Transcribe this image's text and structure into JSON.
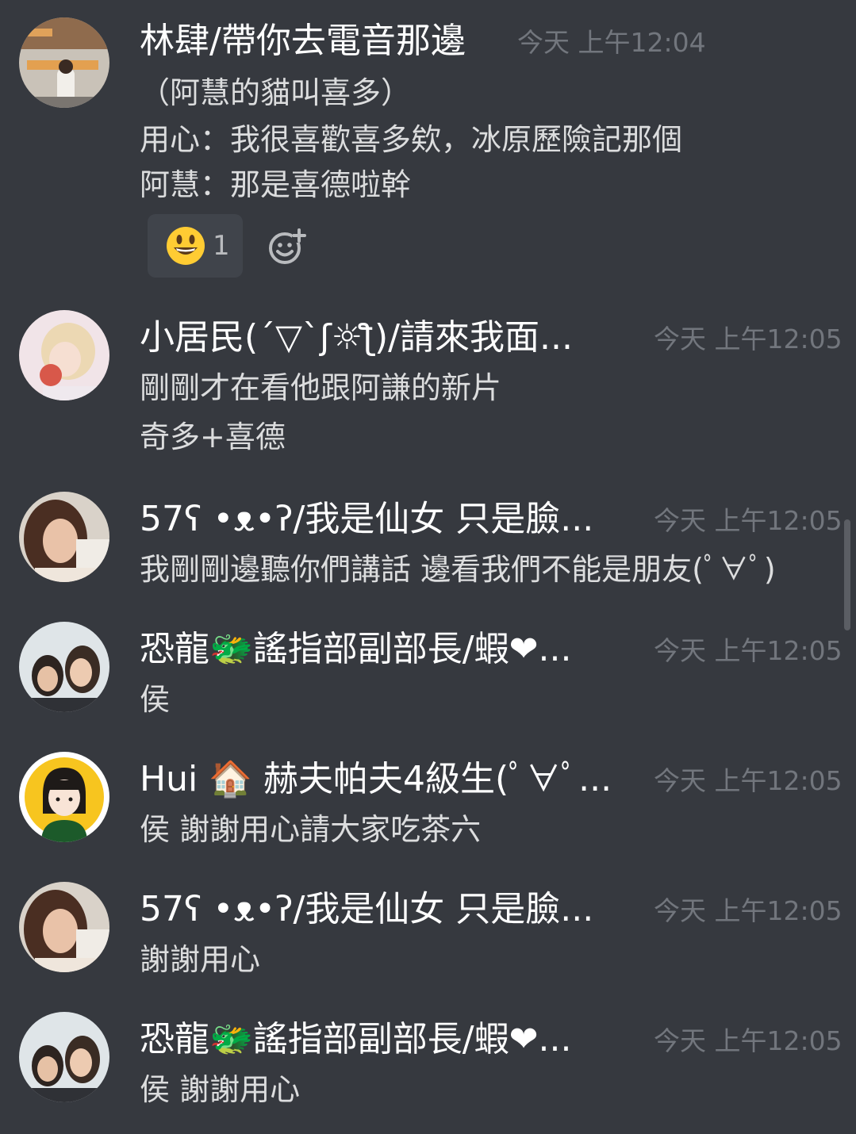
{
  "colors": {
    "background": "#36393f",
    "username": "#ffffff",
    "text": "#dcddde",
    "timestamp": "#72767d",
    "reaction_bg": "#40444b",
    "reaction_count": "#b9bbbe"
  },
  "messages": [
    {
      "username": "林肆/帶你去電音那邊",
      "timestamp": "今天 上午12:04",
      "avatar_icon": "avatar-photo-terminator-poster",
      "lines": [
        "（阿慧的貓叫喜多）",
        "用心：我很喜歡喜多欸，冰原歷險記那個",
        "阿慧：那是喜德啦幹"
      ],
      "reactions": [
        {
          "emoji": "grinning-face-icon",
          "count": "1"
        }
      ]
    },
    {
      "username": "小居民(´▽`ʃ☼ƪ)/請來我面...",
      "timestamp": "今天 上午12:05",
      "avatar_icon": "avatar-photo-blonde-girl",
      "lines": [
        "剛剛才在看他跟阿謙的新片",
        "奇多+喜德"
      ]
    },
    {
      "username": "57ʕ •ᴥ•ʔ/我是仙女 只是臉...",
      "timestamp": "今天 上午12:05",
      "avatar_icon": "avatar-photo-girl-selfie",
      "lines": [
        "我剛剛邊聽你們講話 邊看我們不能是朋友(ﾟ∀ﾟ)"
      ]
    },
    {
      "username": "恐龍🐲謠指部副部長/蝦❤...",
      "timestamp": "今天 上午12:05",
      "avatar_icon": "avatar-photo-two-girls",
      "lines": [
        "侯"
      ]
    },
    {
      "username": "Hui 🏠 赫夫帕夫4級生(ﾟ∀ﾟ...",
      "timestamp": "今天 上午12:05",
      "avatar_icon": "avatar-cartoon-girl-yellow",
      "lines": [
        "侯 謝謝用心請大家吃茶六"
      ]
    },
    {
      "username": "57ʕ •ᴥ•ʔ/我是仙女 只是臉...",
      "timestamp": "今天 上午12:05",
      "avatar_icon": "avatar-photo-girl-selfie",
      "lines": [
        "謝謝用心"
      ]
    },
    {
      "username": "恐龍🐲謠指部副部長/蝦❤...",
      "timestamp": "今天 上午12:05",
      "avatar_icon": "avatar-photo-two-girls",
      "lines": [
        "侯 謝謝用心"
      ]
    }
  ]
}
